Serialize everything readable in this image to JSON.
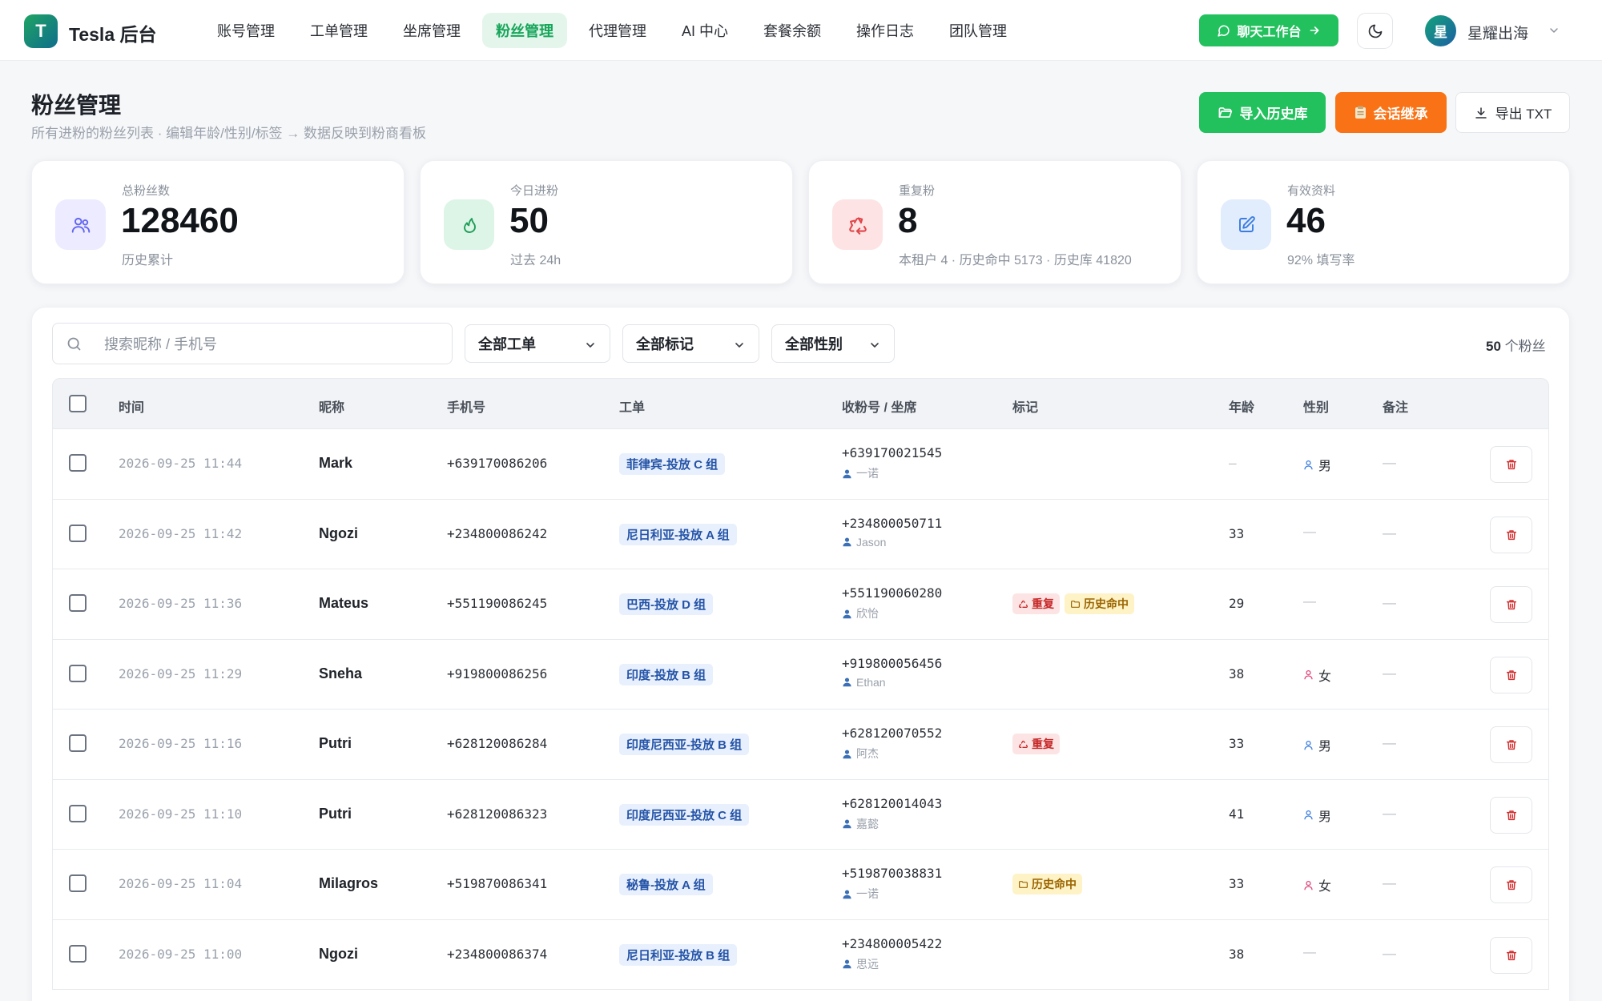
{
  "app": {
    "logo_letter": "T",
    "brand": "Tesla 后台"
  },
  "nav": {
    "items": [
      {
        "label": "账号管理",
        "active": false
      },
      {
        "label": "工单管理",
        "active": false
      },
      {
        "label": "坐席管理",
        "active": false
      },
      {
        "label": "粉丝管理",
        "active": true
      },
      {
        "label": "代理管理",
        "active": false
      },
      {
        "label": "AI 中心",
        "active": false
      },
      {
        "label": "套餐余额",
        "active": false
      },
      {
        "label": "操作日志",
        "active": false
      },
      {
        "label": "团队管理",
        "active": false
      }
    ],
    "chat_button": "聊天工作台",
    "user_avatar": "星",
    "user_name": "星耀出海"
  },
  "page": {
    "title": "粉丝管理",
    "subtitle": "所有进粉的粉丝列表 · 编辑年龄/性别/标签 → 数据反映到粉商看板",
    "import_button": "导入历史库",
    "inherit_button": "会话继承",
    "export_button": "导出 TXT"
  },
  "stats": [
    {
      "label": "总粉丝数",
      "value": "128460",
      "sub": "历史累计",
      "icon": "users-icon"
    },
    {
      "label": "今日进粉",
      "value": "50",
      "sub": "过去 24h",
      "icon": "flame-icon"
    },
    {
      "label": "重复粉",
      "value": "8",
      "sub": "本租户 4 · 历史命中 5173 · 历史库 41820",
      "icon": "recycle-icon"
    },
    {
      "label": "有效资料",
      "value": "46",
      "sub": "92% 填写率",
      "icon": "edit-icon"
    }
  ],
  "filters": {
    "search_placeholder": "搜索昵称 / 手机号",
    "order_select": "全部工单",
    "tag_select": "全部标记",
    "gender_select": "全部性别",
    "count_value": "50",
    "count_unit": "个粉丝"
  },
  "table": {
    "headers": {
      "time": "时间",
      "nickname": "昵称",
      "phone": "手机号",
      "order": "工单",
      "receiver": "收粉号 / 坐席",
      "tags": "标记",
      "age": "年龄",
      "gender": "性别",
      "note": "备注"
    },
    "rows": [
      {
        "time": "2026-09-25 11:44",
        "nickname": "Mark",
        "phone": "+639170086206",
        "order": "菲律宾-投放 C 组",
        "receiver": "+639170021545",
        "seat": "一诺",
        "dup": false,
        "hist": false,
        "age": "—",
        "gender": "男",
        "gender_type": "male",
        "note": "—"
      },
      {
        "time": "2026-09-25 11:42",
        "nickname": "Ngozi",
        "phone": "+234800086242",
        "order": "尼日利亚-投放 A 组",
        "receiver": "+234800050711",
        "seat": "Jason",
        "dup": false,
        "hist": false,
        "age": "33",
        "gender": "—",
        "gender_type": "none",
        "note": "—"
      },
      {
        "time": "2026-09-25 11:36",
        "nickname": "Mateus",
        "phone": "+551190086245",
        "order": "巴西-投放 D 组",
        "receiver": "+551190060280",
        "seat": "欣怡",
        "dup": true,
        "hist": true,
        "age": "29",
        "gender": "—",
        "gender_type": "none",
        "note": "—"
      },
      {
        "time": "2026-09-25 11:29",
        "nickname": "Sneha",
        "phone": "+919800086256",
        "order": "印度-投放 B 组",
        "receiver": "+919800056456",
        "seat": "Ethan",
        "dup": false,
        "hist": false,
        "age": "38",
        "gender": "女",
        "gender_type": "female",
        "note": "—"
      },
      {
        "time": "2026-09-25 11:16",
        "nickname": "Putri",
        "phone": "+628120086284",
        "order": "印度尼西亚-投放 B 组",
        "receiver": "+628120070552",
        "seat": "阿杰",
        "dup": true,
        "hist": false,
        "age": "33",
        "gender": "男",
        "gender_type": "male",
        "note": "—"
      },
      {
        "time": "2026-09-25 11:10",
        "nickname": "Putri",
        "phone": "+628120086323",
        "order": "印度尼西亚-投放 C 组",
        "receiver": "+628120014043",
        "seat": "嘉懿",
        "dup": false,
        "hist": false,
        "age": "41",
        "gender": "男",
        "gender_type": "male",
        "note": "—"
      },
      {
        "time": "2026-09-25 11:04",
        "nickname": "Milagros",
        "phone": "+519870086341",
        "order": "秘鲁-投放 A 组",
        "receiver": "+519870038831",
        "seat": "一诺",
        "dup": false,
        "hist": true,
        "age": "33",
        "gender": "女",
        "gender_type": "female",
        "note": "—"
      },
      {
        "time": "2026-09-25 11:00",
        "nickname": "Ngozi",
        "phone": "+234800086374",
        "order": "尼日利亚-投放 B 组",
        "receiver": "+234800005422",
        "seat": "思远",
        "dup": false,
        "hist": false,
        "age": "38",
        "gender": "—",
        "gender_type": "none",
        "note": "—"
      }
    ],
    "tag_labels": {
      "dup": "重复",
      "hist": "历史命中"
    }
  },
  "colors": {
    "accent": "#22c15e",
    "accent_soft": "#e4f6ec",
    "orange": "#f97316",
    "danger": "#c62828"
  }
}
